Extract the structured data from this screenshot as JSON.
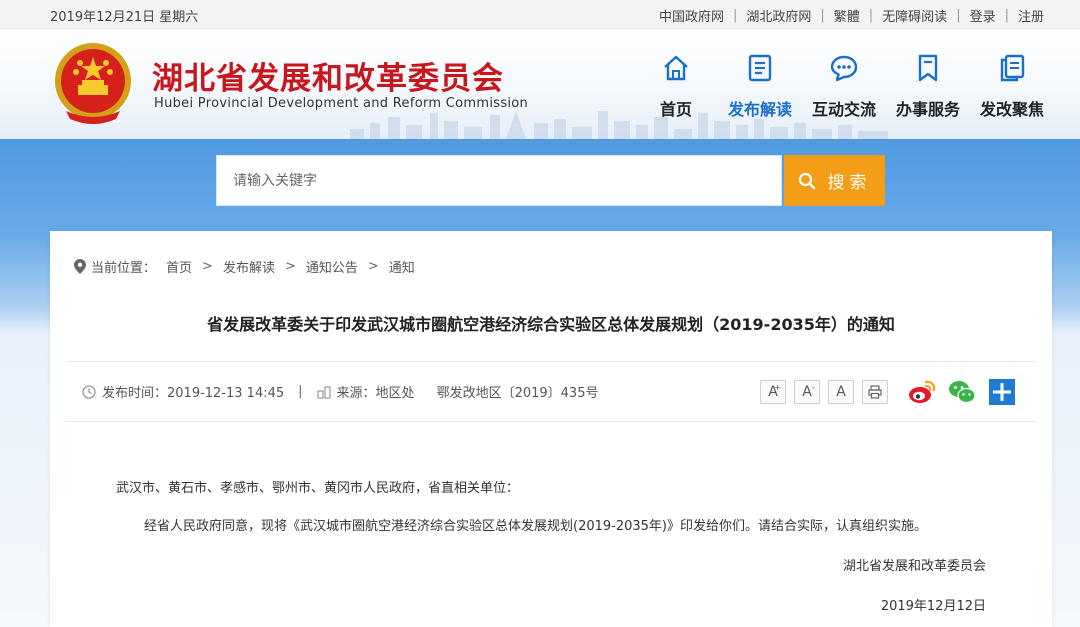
{
  "topbar": {
    "date": "2019年12月21日 星期六",
    "links": [
      "中国政府网",
      "湖北政府网",
      "繁體",
      "无障碍阅读",
      "登录",
      "注册"
    ]
  },
  "header": {
    "title": "湖北省发展和改革委员会",
    "subtitle": "Hubei Provincial Development and Reform Commission",
    "nav": [
      {
        "label": "首页",
        "icon": "home-icon",
        "active": false
      },
      {
        "label": "发布解读",
        "icon": "document-list-icon",
        "active": true
      },
      {
        "label": "互动交流",
        "icon": "chat-bubble-icon",
        "active": false
      },
      {
        "label": "办事服务",
        "icon": "bookmark-icon",
        "active": false
      },
      {
        "label": "发改聚焦",
        "icon": "copy-documents-icon",
        "active": false
      }
    ]
  },
  "search": {
    "placeholder": "请输入关键字",
    "button_label": "搜索"
  },
  "breadcrumb": {
    "label": "当前位置：",
    "items": [
      "首页",
      "发布解读",
      "通知公告",
      "通知"
    ]
  },
  "article": {
    "title": "省发展改革委关于印发武汉城市圈航空港经济综合实验区总体发展规划（2019-2035年）的通知",
    "publish_time": "发布时间：2019-12-13 14:45",
    "source": "来源：地区处",
    "doc_number": "鄂发改地区〔2019〕435号",
    "salutation": "武汉市、黄石市、孝感市、鄂州市、黄冈市人民政府，省直相关单位：",
    "paragraph": "经省人民政府同意，现将《武汉城市圈航空港经济综合实验区总体发展规划(2019-2035年)》印发给你们。请结合实际，认真组织实施。",
    "signer": "湖北省发展和改革委员会",
    "sign_date": "2019年12月12日"
  },
  "tools": {
    "font_large": "A",
    "font_medium": "A",
    "font_small": "A",
    "plus_sup": "+",
    "minus_sup": "-"
  },
  "colors": {
    "brand_red": "#c7161d",
    "accent_blue": "#1a6fc9",
    "search_orange": "#f49d17",
    "weibo_orange": "#e6162d",
    "wechat_green": "#3bb44a",
    "plus_blue": "#1e7ad2"
  }
}
